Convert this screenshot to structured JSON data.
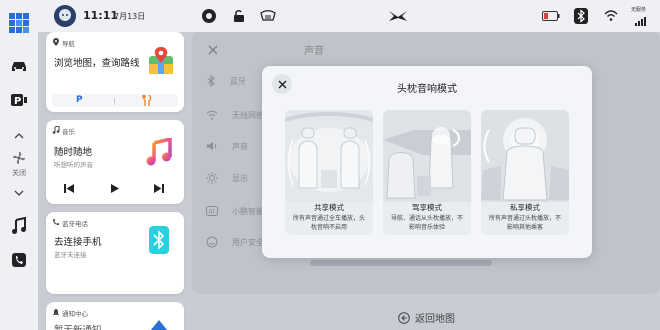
{
  "status_bar": {
    "time": "11:11",
    "date": "7月13日",
    "network_label": "无服务"
  },
  "rail": {
    "fan_label": "关闭"
  },
  "widgets": {
    "navigation": {
      "title": "导航",
      "main": "浏览地图，查询路线",
      "parking_label": "P"
    },
    "music": {
      "title": "音乐",
      "main": "随时随地",
      "sub": "听想听的声音"
    },
    "phone": {
      "title": "蓝牙电话",
      "main": "去连接手机",
      "sub": "蓝牙未连接"
    },
    "notify": {
      "title": "通知中心",
      "main": "暂无新通知"
    }
  },
  "panel": {
    "title": "声音",
    "rows": [
      "蓝牙",
      "无线网络",
      "声音",
      "显示",
      "小鹏智能",
      "用户安全"
    ]
  },
  "back_button": "返回地图",
  "modal": {
    "title": "头枕音响模式",
    "options": [
      {
        "name": "共享模式",
        "desc": "所有声音通过全车播放，头枕音响不启用"
      },
      {
        "name": "驾享模式",
        "desc": "导航、通话从头枕播放，不影响音乐体验"
      },
      {
        "name": "私享模式",
        "desc": "所有声音通过头枕播放，不影响其他乘客"
      }
    ]
  },
  "colors": {
    "accent_blue": "#2a6fd6",
    "map_red": "#e8453c",
    "music_pink": "#f0508a",
    "bluetooth_cyan": "#2ad0e0"
  }
}
